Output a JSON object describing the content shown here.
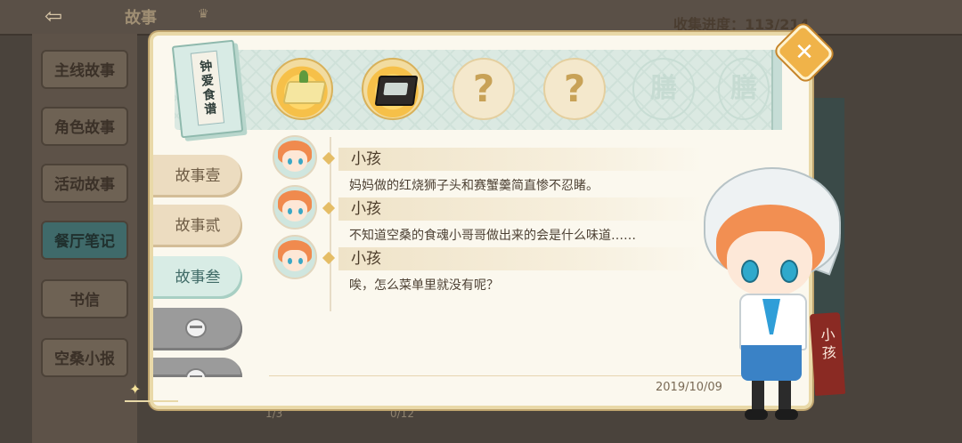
{
  "background": {
    "title": "故事",
    "progress": "收集进度：113/214",
    "sidebar": [
      {
        "label": "主线故事",
        "active": false
      },
      {
        "label": "角色故事",
        "active": false
      },
      {
        "label": "活动故事",
        "active": false
      },
      {
        "label": "餐厅笔记",
        "active": true
      },
      {
        "label": "书信",
        "active": false
      },
      {
        "label": "空桑小报",
        "active": false
      }
    ],
    "counts": [
      "1/3",
      "0/12"
    ]
  },
  "dialog": {
    "book_title": "钟爱食谱",
    "recipe_slots": [
      {
        "state": "filled",
        "dish": "tofu"
      },
      {
        "state": "filled",
        "dish": "crab-box"
      },
      {
        "state": "unknown",
        "symbol": "?"
      },
      {
        "state": "unknown",
        "symbol": "?"
      },
      {
        "state": "locked",
        "symbol": "膳"
      },
      {
        "state": "locked",
        "symbol": "膳"
      }
    ],
    "close_label": "✕",
    "tabs": [
      {
        "label": "故事壹",
        "state": "normal"
      },
      {
        "label": "故事贰",
        "state": "normal"
      },
      {
        "label": "故事叁",
        "state": "active"
      },
      {
        "label": "",
        "state": "locked"
      },
      {
        "label": "",
        "state": "locked"
      }
    ],
    "lines": [
      {
        "speaker": "小孩",
        "text": "妈妈做的红烧狮子头和赛蟹羹简直惨不忍睹。"
      },
      {
        "speaker": "小孩",
        "text": "不知道空桑的食魂小哥哥做出来的会是什么味道……"
      },
      {
        "speaker": "小孩",
        "text": "唉，怎么菜单里就没有呢？"
      }
    ],
    "date": "2019/10/09",
    "character_name": "小孩"
  },
  "colors": {
    "accent_gold": "#f0b349",
    "teal_active": "#d8ece5",
    "banner_red": "#8a2a23",
    "paper": "#fbf8ee"
  }
}
